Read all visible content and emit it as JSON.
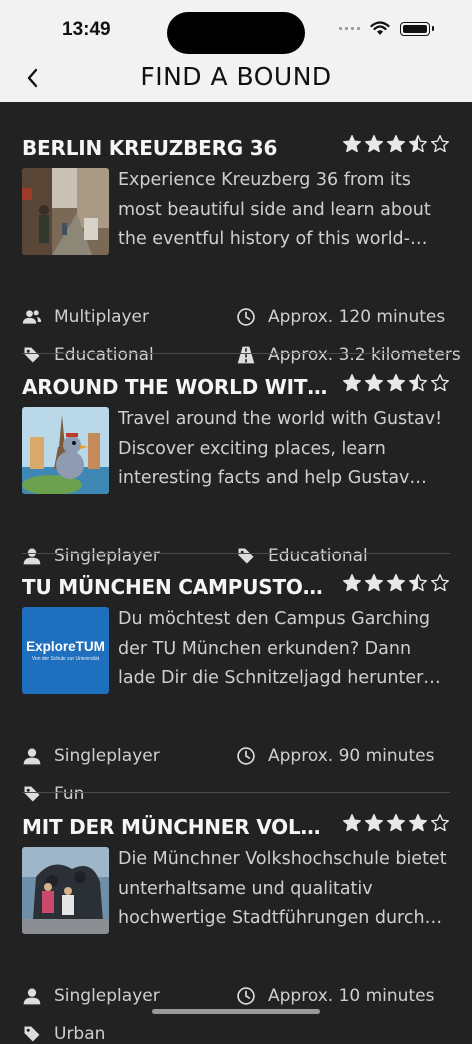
{
  "status": {
    "time": "13:49"
  },
  "nav": {
    "title": "FIND A BOUND"
  },
  "cards": [
    {
      "title": "BERLIN KREUZBERG 36",
      "rating": 3.5,
      "description": "Experience Kreuzberg 36 from its most beautiful side and learn about the eventful history of this world-famous district",
      "meta": [
        {
          "icon": "multiplayer-icon",
          "text": "Multiplayer"
        },
        {
          "icon": "clock-icon",
          "text": "Approx. 120 minutes"
        },
        {
          "icon": "tag-icon",
          "text": "Educational"
        },
        {
          "icon": "road-icon",
          "text": "Approx. 3.2 kilometers"
        }
      ]
    },
    {
      "title": "AROUND THE WORLD WITH A...",
      "rating": 3.5,
      "description": "Travel around the world with Gustav! Discover exciting places, learn interesting facts and help Gustav write his book",
      "meta": [
        {
          "icon": "singleplayer-icon",
          "text": "Singleplayer"
        },
        {
          "icon": "tag-icon",
          "text": "Educational"
        }
      ]
    },
    {
      "title": "TU MÜNCHEN CAMPUSTOUR ...",
      "rating": 3.5,
      "description": "Du möchtest den Campus Garching der TU München erkunden? Dann lade Dir die Schnitzeljagd herunter und lass dich überraschen",
      "thumb_title": "ExploreTUM",
      "thumb_subtitle": "Von der Schule zur Universität",
      "meta": [
        {
          "icon": "singleplayer-icon",
          "text": "Singleplayer"
        },
        {
          "icon": "clock-icon",
          "text": "Approx. 90 minutes"
        },
        {
          "icon": "tag-icon",
          "text": "Fun"
        }
      ]
    },
    {
      "title": "MIT DER MÜNCHNER VOLKSH...",
      "rating": 4,
      "description": "Die Münchner Volkshochschule bietet unterhaltsame und qualitativ hochwertige Stadtführungen durch München an",
      "meta": [
        {
          "icon": "singleplayer-icon",
          "text": "Singleplayer"
        },
        {
          "icon": "clock-icon",
          "text": "Approx. 10 minutes"
        },
        {
          "icon": "tag-icon",
          "text": "Urban"
        }
      ]
    }
  ],
  "colors": {
    "background": "#222222",
    "header": "#f2f2f2",
    "text": "#cfcfcf",
    "accent_blue": "#1f6fbf"
  }
}
